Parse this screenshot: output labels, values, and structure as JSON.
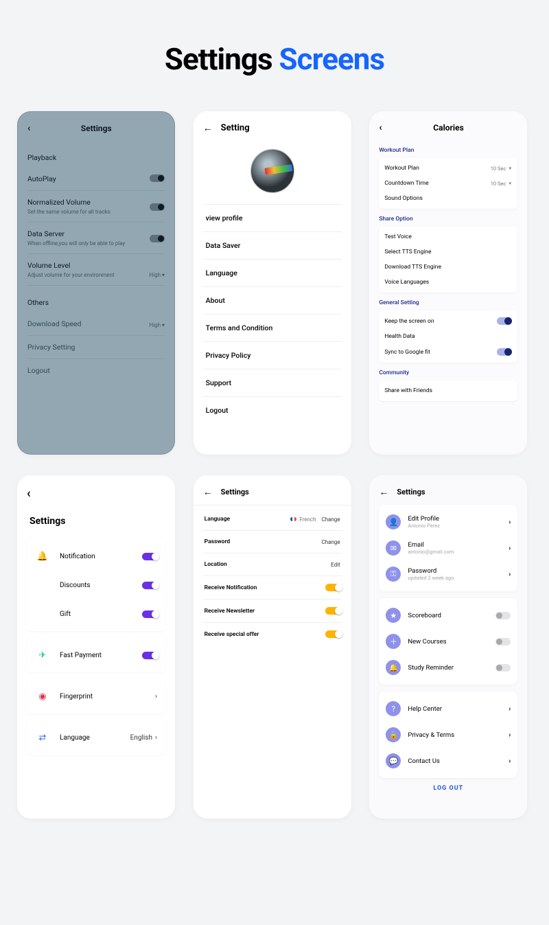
{
  "title": {
    "part1": "Settings ",
    "part2": "Screens"
  },
  "s1": {
    "header": "Settings",
    "sections": {
      "playback": {
        "title": "Playback"
      },
      "others": {
        "title": "Others"
      }
    },
    "autoplay": {
      "label": "AutoPlay"
    },
    "normalized": {
      "label": "Normalized Volume",
      "sub": "Set the same volume for all tracks"
    },
    "dataserver": {
      "label": "Data Server",
      "sub": "When offline,you will only be able to play"
    },
    "volume": {
      "label": "Volume Level",
      "sub": "Adjust volume for your environment",
      "value": "High"
    },
    "download": {
      "label": "Download Speed",
      "value": "High"
    },
    "privacy": {
      "label": "Privacy Setting"
    },
    "logout": {
      "label": "Logout"
    }
  },
  "s2": {
    "header": "Setting",
    "items": [
      "view profile",
      "Data Saver",
      "Language",
      "About",
      "Terms and Condition",
      "Privacy Policy",
      "Support",
      "Logout"
    ]
  },
  "s3": {
    "header": "Calories",
    "groups": {
      "workout": {
        "title": "Workout Plan",
        "rows": [
          {
            "label": "Workout Plan",
            "value": "10 Sec"
          },
          {
            "label": "Countdown Time",
            "value": "10 Sec"
          },
          {
            "label": "Sound Options"
          }
        ]
      },
      "share": {
        "title": "Share Option",
        "rows": [
          {
            "label": "Test Voice"
          },
          {
            "label": "Select TTS Engine"
          },
          {
            "label": "Download TTS Engine"
          },
          {
            "label": "Voice Languages"
          }
        ]
      },
      "general": {
        "title": "General Setting",
        "rows": [
          {
            "label": "Keep the screen on",
            "toggle": true
          },
          {
            "label": "Health Data"
          },
          {
            "label": "Sync to Google fit",
            "toggle": true
          }
        ]
      },
      "community": {
        "title": "Community",
        "rows": [
          {
            "label": "Share with Friends"
          }
        ]
      }
    }
  },
  "s4": {
    "header": "Settings",
    "notification": {
      "label": "Notification"
    },
    "discounts": {
      "label": "Discounts"
    },
    "gift": {
      "label": "Gift"
    },
    "fastpayment": {
      "label": "Fast Payment"
    },
    "fingerprint": {
      "label": "Fingerprint"
    },
    "language": {
      "label": "Language",
      "value": "English"
    }
  },
  "s5": {
    "header": "Settings",
    "language": {
      "label": "Language",
      "value": "French",
      "action": "Change"
    },
    "password": {
      "label": "Password",
      "action": "Change"
    },
    "location": {
      "label": "Location",
      "action": "Edit"
    },
    "notif": {
      "label": "Receive Notification"
    },
    "newsletter": {
      "label": "Receive Newsletter"
    },
    "offer": {
      "label": "Receive special offer"
    }
  },
  "s6": {
    "header": "Settings",
    "profile": {
      "title": "Edit Profile",
      "sub": "Antonio Perez"
    },
    "email": {
      "title": "Email",
      "sub": "antonio@gmail.com"
    },
    "password": {
      "title": "Password",
      "sub": "updated 2 week ago"
    },
    "scoreboard": {
      "title": "Scoreboard"
    },
    "courses": {
      "title": "New Courses"
    },
    "reminder": {
      "title": "Study Reminder"
    },
    "help": {
      "title": "Help Center"
    },
    "privacy": {
      "title": "Privacy & Terms"
    },
    "contact": {
      "title": "Contact Us"
    },
    "logout": "LOG OUT"
  }
}
